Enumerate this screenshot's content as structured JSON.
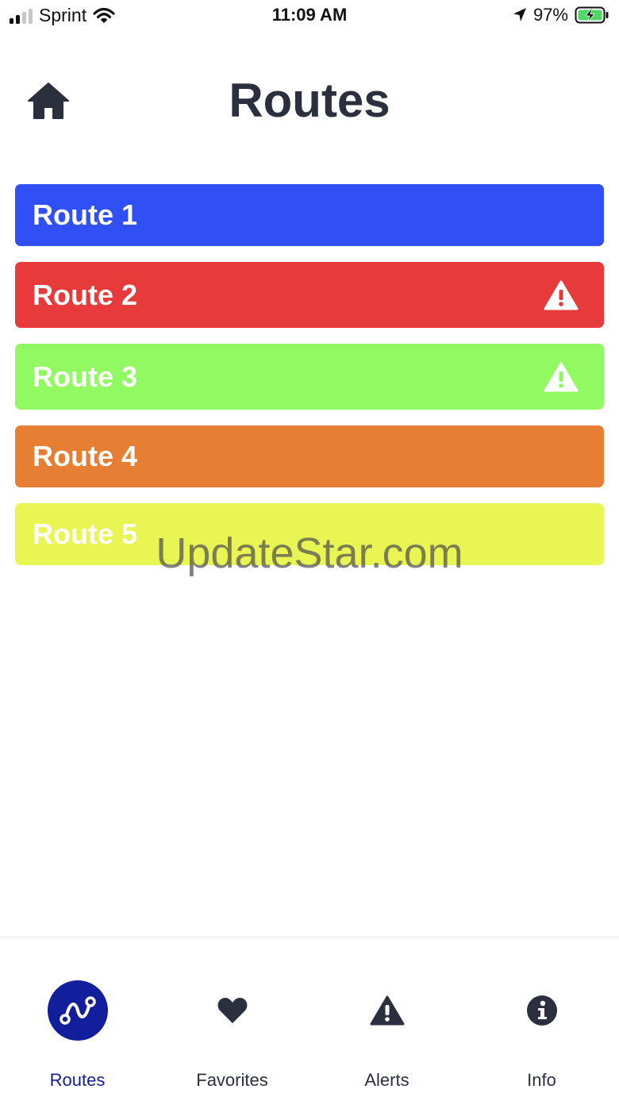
{
  "status_bar": {
    "carrier": "Sprint",
    "time": "11:09 AM",
    "battery": "97%"
  },
  "header": {
    "title": "Routes",
    "home_icon": "home-icon"
  },
  "routes": [
    {
      "label": "Route 1",
      "color": "#3050f5",
      "alert": false
    },
    {
      "label": "Route 2",
      "color": "#e73a3a",
      "alert": true
    },
    {
      "label": "Route 3",
      "color": "#91f962",
      "alert": true
    },
    {
      "label": "Route 4",
      "color": "#e67e34",
      "alert": false
    },
    {
      "label": "Route 5",
      "color": "#e9f553",
      "alert": false
    }
  ],
  "watermark": "UpdateStar.com",
  "tabs": [
    {
      "label": "Routes",
      "icon": "route-icon",
      "active": true
    },
    {
      "label": "Favorites",
      "icon": "heart-icon",
      "active": false
    },
    {
      "label": "Alerts",
      "icon": "alert-triangle-icon",
      "active": false
    },
    {
      "label": "Info",
      "icon": "info-icon",
      "active": false
    }
  ],
  "colors": {
    "accent": "#131e9c",
    "text_dark": "#2b2f3e"
  }
}
